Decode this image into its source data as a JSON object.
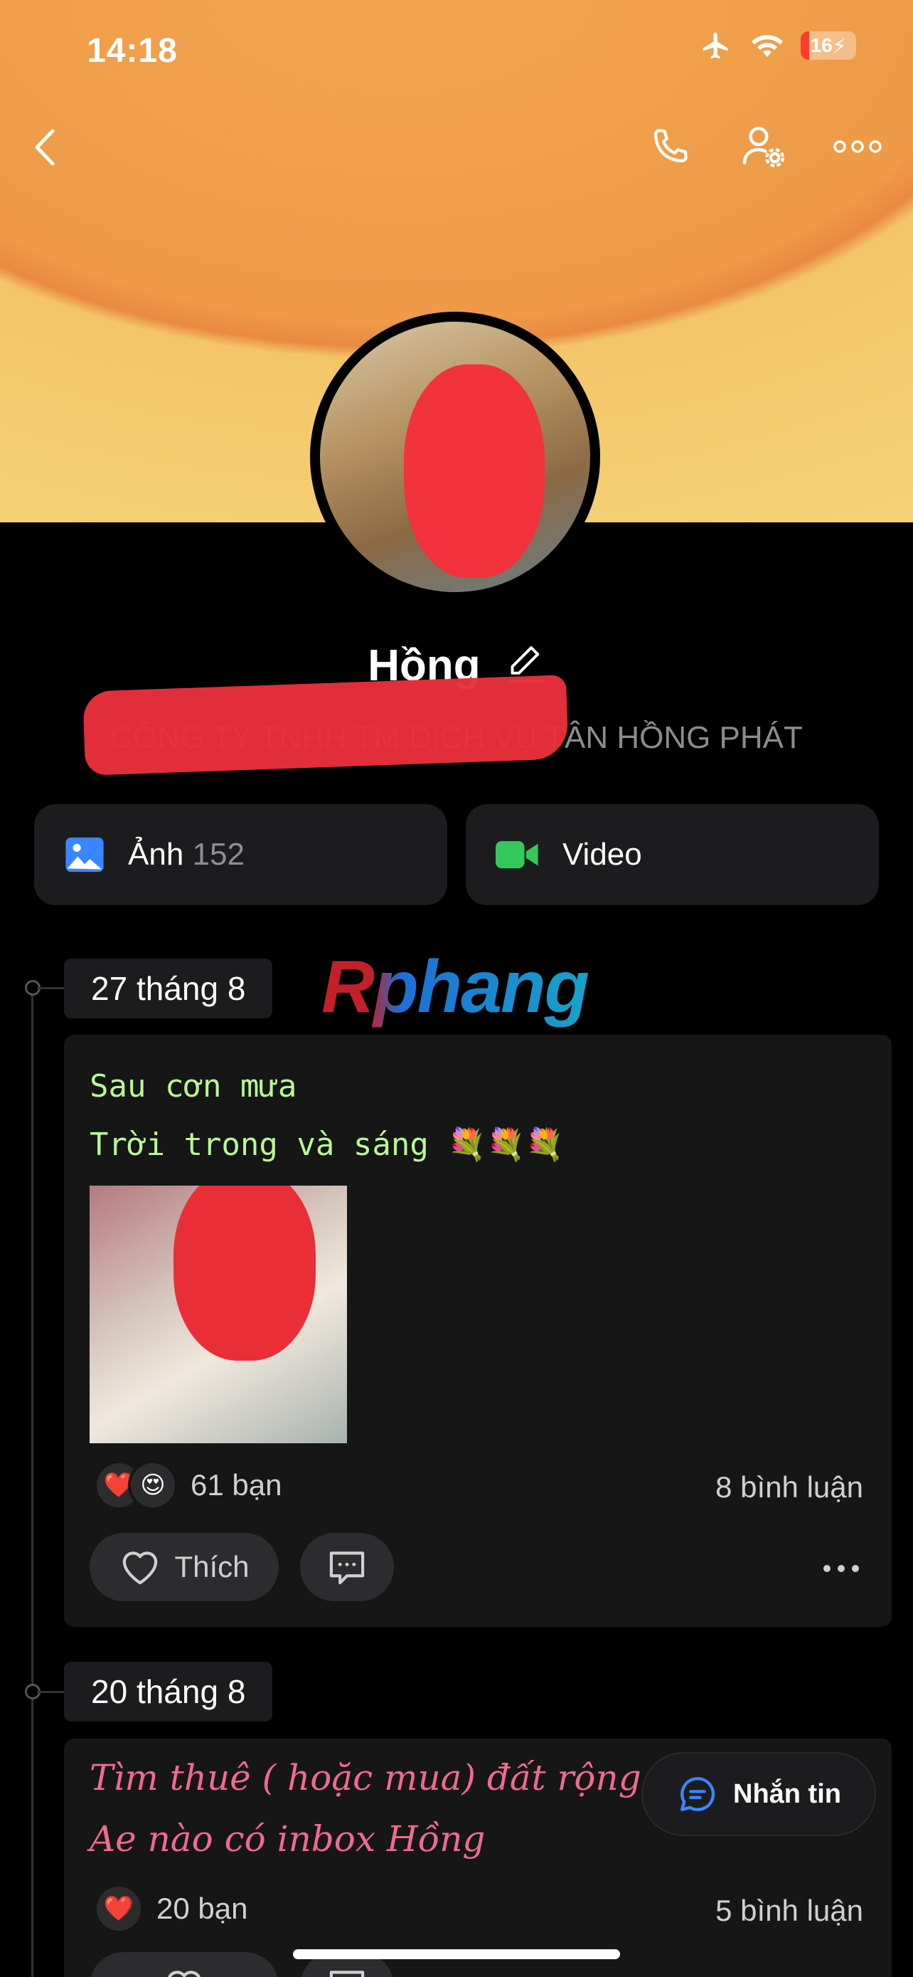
{
  "status_bar": {
    "time": "14:18",
    "battery": "16"
  },
  "profile": {
    "name": "Hồng",
    "company": "CÔNG TY TNHH TM DỊCH VỤ TÂN HỒNG PHÁT"
  },
  "media": {
    "photos_label": "Ảnh",
    "photos_count": "152",
    "video_label": "Video"
  },
  "watermark": "Rphang",
  "posts": [
    {
      "date": "27 tháng 8",
      "lines": [
        "Sau cơn mưa",
        "Trời trong và sáng 💐💐💐"
      ],
      "reaction_icons": [
        "❤️",
        "😍"
      ],
      "reactions": "61 bạn",
      "comments": "8 bình luận",
      "like_label": "Thích"
    },
    {
      "date": "20 tháng 8",
      "lines": [
        "Tìm thuê ( hoặc mua) đất rộng tại Dĩ An",
        "Ae nào có inbox Hồng"
      ],
      "reaction_icons": [
        "❤️"
      ],
      "reactions": "20 bạn",
      "comments": "5 bình luận"
    }
  ],
  "fab": {
    "label": "Nhắn tin"
  },
  "colors": {
    "accent": "#3a86ff",
    "video": "#34c759",
    "post1_text": "#b8f797",
    "post2_text": "#f06a8f"
  }
}
